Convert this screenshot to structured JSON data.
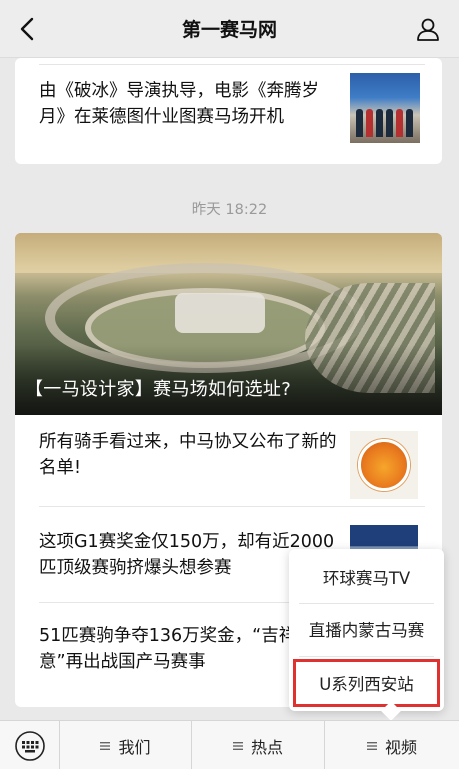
{
  "header": {
    "title": "第一赛马网",
    "back_icon": "chevron-left-icon",
    "profile_icon": "person-icon"
  },
  "feed": {
    "first_article": {
      "title": "由《破冰》导演执导，电影《奔腾岁月》在莱德图什业图赛马场开机"
    },
    "timestamp": "昨天 18:22",
    "hero_article": {
      "title": "【一马设计家】赛马场如何选址?"
    },
    "articles": [
      {
        "title": "所有骑手看过来，中马协又公布了新的名单!"
      },
      {
        "title": "这项G1赛奖金仅150万，却有近2000匹顶级赛驹挤爆头想参赛"
      },
      {
        "title": "51匹赛驹争夺136万奖金，“吉祥如意”再出战国产马赛事"
      }
    ]
  },
  "popup_menu": {
    "items": [
      {
        "label": "环球赛马TV"
      },
      {
        "label": "直播内蒙古马赛"
      },
      {
        "label": "U系列西安站",
        "highlighted": true
      }
    ],
    "highlight_color": "#e03131"
  },
  "bottom_bar": {
    "keyboard_icon": "keyboard-icon",
    "tabs": [
      {
        "label": "我们",
        "icon": "menu-icon"
      },
      {
        "label": "热点",
        "icon": "menu-icon"
      },
      {
        "label": "视频",
        "icon": "menu-icon"
      }
    ]
  }
}
